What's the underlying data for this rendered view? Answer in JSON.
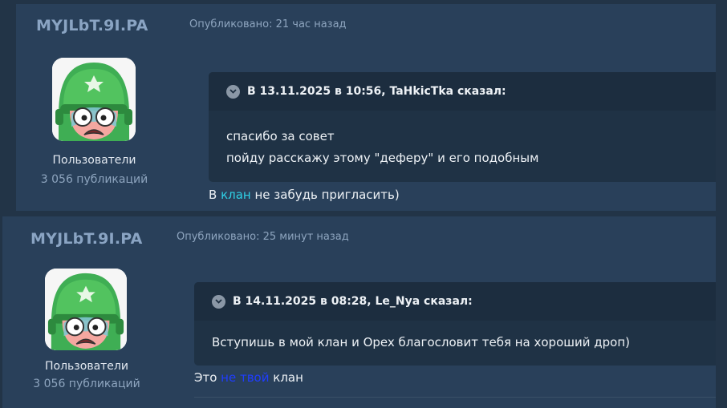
{
  "colors": {
    "page_bg": "#223447",
    "post_bg": "#29405a",
    "quote_bg": "#1f3245",
    "quote_header_bg": "#1c2d3f",
    "author_name": "#8aa4c3",
    "link_cyan": "#2fd0e6",
    "link_blue": "#1f3dff"
  },
  "posts": [
    {
      "author": "MYJLbT.9I.PA",
      "date": "Опубликовано: 21 час назад",
      "group": "Пользователи",
      "post_count": "3 056 публикаций",
      "quote": {
        "toggle_icon": "chevron-down-icon",
        "header": "В 13.11.2025 в 10:56, TaHkicTka сказал:",
        "lines": [
          "спасибо за совет",
          "пойду расскажу этому \"деферу\" и его подобным"
        ]
      },
      "reply": {
        "before": "В ",
        "link": "клан",
        "after": " не забудь пригласить)"
      }
    },
    {
      "author": "MYJLbT.9I.PA",
      "date": "Опубликовано: 25 минут назад",
      "group": "Пользователи",
      "post_count": "3 056 публикаций",
      "quote": {
        "toggle_icon": "chevron-down-icon",
        "header": "В 14.11.2025 в 08:28, Le_Nya сказал:",
        "lines": [
          "Вступишь в мой клан и Opex благословит тебя на хороший дроп)"
        ]
      },
      "reply": {
        "before": "Это ",
        "link": "не твой",
        "after": " клан"
      }
    }
  ]
}
